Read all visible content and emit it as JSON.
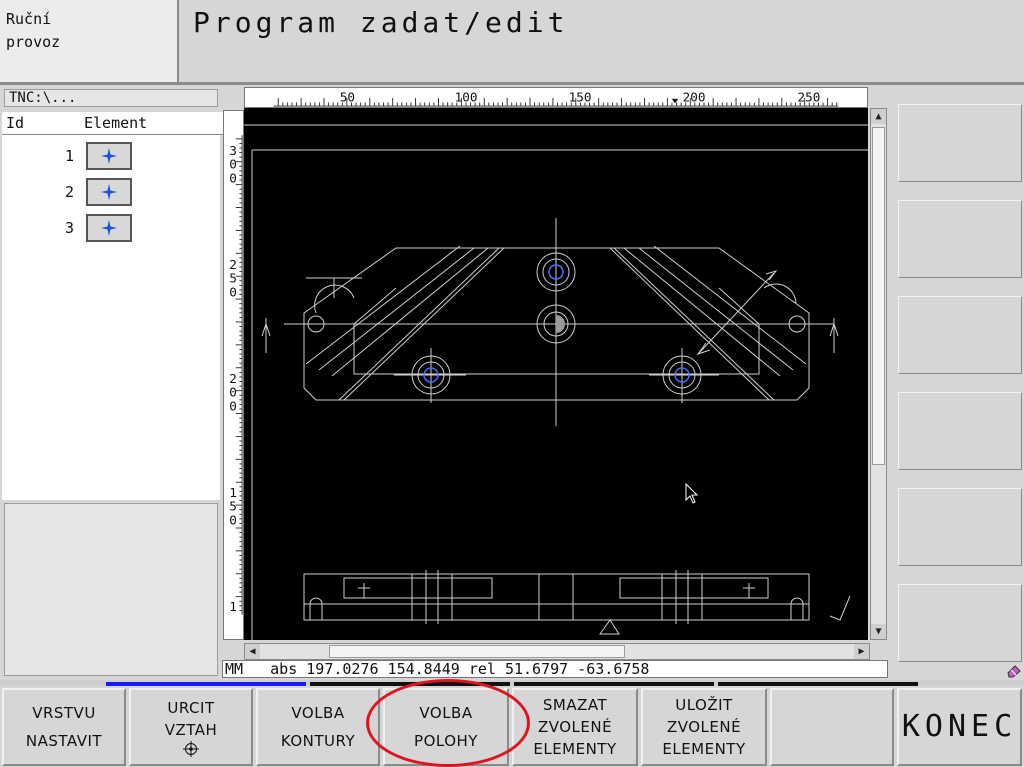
{
  "header": {
    "mode_line1": "Ruční",
    "mode_line2": "provoz",
    "title": "Program zadat/edit"
  },
  "left_panel": {
    "path": "TNC:\\...",
    "col_id": "Id",
    "col_element": "Element",
    "rows": [
      {
        "id": "1",
        "icon": "point-crosshair-icon"
      },
      {
        "id": "2",
        "icon": "point-crosshair-icon"
      },
      {
        "id": "3",
        "icon": "point-crosshair-icon"
      }
    ]
  },
  "ruler": {
    "h_labels": [
      "50",
      "100",
      "150",
      "200",
      "250"
    ],
    "v_labels": [
      [
        "3",
        "0",
        "0"
      ],
      [
        "2",
        "5",
        "0"
      ],
      [
        "2",
        "0",
        "0"
      ],
      [
        "1",
        "5",
        "0"
      ],
      [
        "1"
      ]
    ]
  },
  "status": {
    "text": "MM   abs 197.0276 154.8449 rel 51.6797 -63.6758"
  },
  "softkeys": {
    "vrstvu_line1": "VRSTVU",
    "vrstvu_line2": "NASTAVIT",
    "urcit_line1": "URCIT",
    "urcit_line2": "VZTAH",
    "volba_kontury_line1": "VOLBA",
    "volba_kontury_line2": "KONTURY",
    "volba_polohy_line1": "VOLBA",
    "volba_polohy_line2": "POLOHY",
    "smazat_line1": "SMAZAT",
    "smazat_line2": "ZVOLENÉ",
    "smazat_line3": "ELEMENTY",
    "ulozit_line1": "ULOŽIT",
    "ulozit_line2": "ZVOLENÉ",
    "ulozit_line3": "ELEMENTY",
    "konec": "KONEC"
  },
  "colors": {
    "canvas_bg": "#000000",
    "drawing_lines": "#d0d0d0",
    "selected_points": "#4a6cff",
    "highlight_ellipse": "#e0141e",
    "softbar_blue": "#1a1aff"
  }
}
